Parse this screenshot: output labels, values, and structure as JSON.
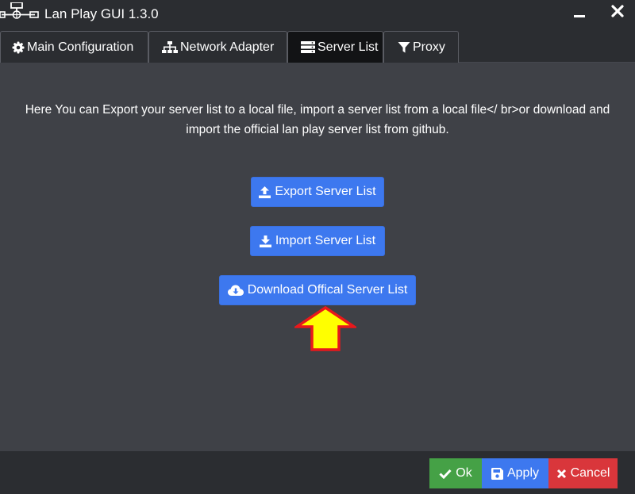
{
  "window": {
    "title": "Lan Play GUI 1.3.0"
  },
  "tabs": [
    {
      "label": "Main Configuration",
      "icon": "gear-icon"
    },
    {
      "label": "Network Adapter",
      "icon": "network-icon"
    },
    {
      "label": "Server List",
      "icon": "server-icon",
      "active": true
    },
    {
      "label": "Proxy",
      "icon": "filter-icon"
    }
  ],
  "main": {
    "description": "Here You can Export your server list to a local file, import a server list from a local file</ br>or download and import the official lan play server list from github.",
    "buttons": {
      "export": "Export Server List",
      "import": "Import Server List",
      "download": "Download Offical Server List"
    }
  },
  "footer": {
    "ok": "Ok",
    "apply": "Apply",
    "cancel": "Cancel"
  },
  "colors": {
    "primary": "#3d78ef",
    "success": "#45a146",
    "danger": "#d9363b",
    "background": "#3f4147",
    "chrome": "#2b2d31",
    "arrow_fill": "#ffff00",
    "arrow_stroke": "#e8181b"
  }
}
